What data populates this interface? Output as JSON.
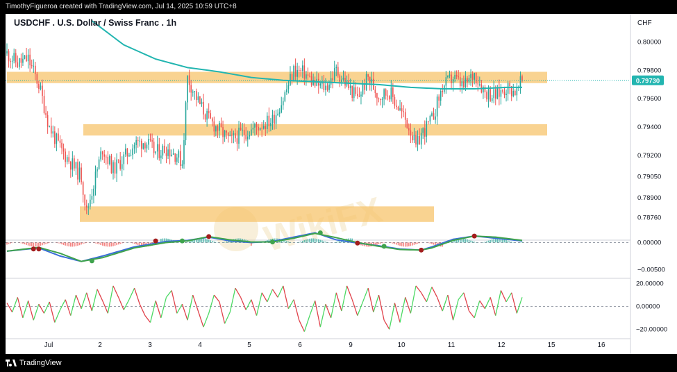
{
  "header": {
    "credit": "TimothyFigueroa created with TradingView.com, Jul 14, 2025 10:59 UTC+8"
  },
  "chart": {
    "title": "USDCHF . U.S. Dollar / Swiss Franc . 1h",
    "currency": "CHF",
    "watermark": "WikiFX",
    "footer_brand": "TradingView",
    "colors": {
      "up": "#26a69a",
      "down": "#ef5350",
      "zone": "#f7c46c",
      "ma": "#22b5b0",
      "macd_fast": "#3a6ed8",
      "macd_signal": "#3fa34d",
      "macd_down": "#a31d1d",
      "osc_up": "#4cd964",
      "osc_down": "#e0414a"
    }
  },
  "chart_data": [
    {
      "type": "candlestick",
      "title": "USDCHF . U.S. Dollar / Swiss Franc . 1h",
      "y_ticks": [
        0.8,
        0.798,
        0.796,
        0.794,
        0.792,
        0.7905,
        0.789,
        0.7876
      ],
      "y_tick_labels": [
        "0.80000",
        "0.79800",
        "0.79600",
        "0.79400",
        "0.79200",
        "0.79050",
        "0.78900",
        "0.78760"
      ],
      "ylim": [
        0.7868,
        0.8015
      ],
      "x_tick_labels": [
        "Jul",
        "2",
        "3",
        "4",
        "5",
        "6",
        "9",
        "10",
        "11",
        "12",
        "15",
        "16"
      ],
      "last_price": 0.7973,
      "last_price_label": "0.79730",
      "zones": [
        {
          "low": 0.7971,
          "high": 0.7979
        },
        {
          "low": 0.7934,
          "high": 0.7942
        },
        {
          "low": 0.7873,
          "high": 0.7884
        }
      ],
      "price_path": [
        [
          0,
          0.7992
        ],
        [
          2,
          0.7985
        ],
        [
          4,
          0.7988
        ],
        [
          6,
          0.797
        ],
        [
          8,
          0.794
        ],
        [
          10,
          0.7925
        ],
        [
          12,
          0.7915
        ],
        [
          14,
          0.7905
        ],
        [
          15,
          0.788
        ],
        [
          16,
          0.7895
        ],
        [
          18,
          0.7925
        ],
        [
          20,
          0.791
        ],
        [
          22,
          0.7918
        ],
        [
          24,
          0.7928
        ],
        [
          26,
          0.793
        ],
        [
          28,
          0.7922
        ],
        [
          30,
          0.7925
        ],
        [
          32,
          0.792
        ],
        [
          33,
          0.7915
        ],
        [
          34,
          0.7975
        ],
        [
          36,
          0.7958
        ],
        [
          38,
          0.7945
        ],
        [
          40,
          0.7938
        ],
        [
          42,
          0.793
        ],
        [
          44,
          0.7935
        ],
        [
          46,
          0.7938
        ],
        [
          48,
          0.7942
        ],
        [
          50,
          0.7945
        ],
        [
          52,
          0.796
        ],
        [
          54,
          0.798
        ],
        [
          56,
          0.7978
        ],
        [
          58,
          0.797
        ],
        [
          60,
          0.7968
        ],
        [
          62,
          0.798
        ],
        [
          64,
          0.797
        ],
        [
          66,
          0.796
        ],
        [
          68,
          0.7975
        ],
        [
          70,
          0.7962
        ],
        [
          72,
          0.7965
        ],
        [
          74,
          0.7952
        ],
        [
          76,
          0.7938
        ],
        [
          77,
          0.7925
        ],
        [
          78,
          0.7935
        ],
        [
          80,
          0.7945
        ],
        [
          82,
          0.7968
        ],
        [
          84,
          0.7975
        ],
        [
          86,
          0.7968
        ],
        [
          88,
          0.7978
        ],
        [
          90,
          0.7965
        ],
        [
          92,
          0.7962
        ],
        [
          94,
          0.7968
        ],
        [
          96,
          0.7965
        ],
        [
          97,
          0.7973
        ]
      ],
      "ma_path": [
        [
          16,
          0.8015
        ],
        [
          22,
          0.7998
        ],
        [
          28,
          0.7988
        ],
        [
          34,
          0.7982
        ],
        [
          40,
          0.7979
        ],
        [
          46,
          0.7975
        ],
        [
          52,
          0.7973
        ],
        [
          58,
          0.7972
        ],
        [
          64,
          0.7971
        ],
        [
          70,
          0.797
        ],
        [
          76,
          0.7968
        ],
        [
          82,
          0.7967
        ],
        [
          88,
          0.7967
        ],
        [
          94,
          0.7968
        ],
        [
          97,
          0.7968
        ]
      ]
    },
    {
      "type": "line",
      "name": "MACD",
      "y_ticks": [
        0.0,
        -0.005
      ],
      "y_tick_labels": [
        "0.00000",
        "−0.00500"
      ],
      "ylim": [
        -0.0065,
        0.0025
      ],
      "series": [
        {
          "name": "fast",
          "values": [
            [
              0,
              -0.0016
            ],
            [
              6,
              -0.001
            ],
            [
              10,
              -0.0025
            ],
            [
              14,
              -0.0035
            ],
            [
              18,
              -0.0025
            ],
            [
              24,
              -0.0008
            ],
            [
              30,
              0.0002
            ],
            [
              34,
              0.0004
            ],
            [
              38,
              0.001
            ],
            [
              42,
              0.0003
            ],
            [
              46,
              0.0
            ],
            [
              50,
              0.0002
            ],
            [
              54,
              0.001
            ],
            [
              58,
              0.0018
            ],
            [
              62,
              0.0005
            ],
            [
              66,
              -0.0001
            ],
            [
              70,
              -0.0006
            ],
            [
              74,
              -0.0012
            ],
            [
              78,
              -0.0014
            ],
            [
              80,
              -0.0008
            ],
            [
              84,
              0.0006
            ],
            [
              88,
              0.0012
            ],
            [
              92,
              0.0008
            ],
            [
              97,
              0.0003
            ]
          ]
        },
        {
          "name": "signal",
          "values": [
            [
              0,
              -0.0016
            ],
            [
              6,
              -0.0009
            ],
            [
              10,
              -0.002
            ],
            [
              14,
              -0.0035
            ],
            [
              18,
              -0.0028
            ],
            [
              24,
              -0.001
            ],
            [
              30,
              0.0
            ],
            [
              34,
              0.0003
            ],
            [
              38,
              0.0011
            ],
            [
              42,
              0.0005
            ],
            [
              46,
              0.0001
            ],
            [
              50,
              0.0001
            ],
            [
              54,
              0.0008
            ],
            [
              58,
              0.0017
            ],
            [
              62,
              0.0009
            ],
            [
              66,
              0.0
            ],
            [
              70,
              -0.0007
            ],
            [
              74,
              -0.0013
            ],
            [
              78,
              -0.0014
            ],
            [
              80,
              -0.001
            ],
            [
              84,
              0.0004
            ],
            [
              88,
              0.0012
            ],
            [
              92,
              0.001
            ],
            [
              97,
              0.0004
            ]
          ]
        }
      ],
      "cross_markers": [
        [
          5,
          -0.0012,
          "down"
        ],
        [
          6,
          -0.0012,
          "down"
        ],
        [
          16,
          -0.0034,
          "up"
        ],
        [
          28,
          0.0003,
          "down"
        ],
        [
          33,
          0.0003,
          "up"
        ],
        [
          38,
          0.0011,
          "down"
        ],
        [
          50,
          0.0001,
          "up"
        ],
        [
          59,
          0.0018,
          "up"
        ],
        [
          66,
          -0.0001,
          "down"
        ],
        [
          71,
          -0.0007,
          "up"
        ],
        [
          78,
          -0.0014,
          "down"
        ],
        [
          88,
          0.0012,
          "down"
        ]
      ]
    },
    {
      "type": "line",
      "name": "Oscillator",
      "y_ticks": [
        20,
        0,
        -20
      ],
      "y_tick_labels": [
        "20.00000",
        "0.00000",
        "−20.00000"
      ],
      "ylim": [
        -27,
        24
      ],
      "values": [
        [
          0,
          3
        ],
        [
          1,
          -5
        ],
        [
          2,
          8
        ],
        [
          3,
          -10
        ],
        [
          4,
          5
        ],
        [
          5,
          -12
        ],
        [
          6,
          2
        ],
        [
          7,
          -6
        ],
        [
          8,
          4
        ],
        [
          9,
          -14
        ],
        [
          10,
          -3
        ],
        [
          11,
          6
        ],
        [
          12,
          -8
        ],
        [
          13,
          10
        ],
        [
          14,
          -2
        ],
        [
          15,
          12
        ],
        [
          16,
          -4
        ],
        [
          17,
          15
        ],
        [
          18,
          5
        ],
        [
          19,
          -6
        ],
        [
          20,
          18
        ],
        [
          21,
          8
        ],
        [
          22,
          -3
        ],
        [
          23,
          6
        ],
        [
          24,
          16
        ],
        [
          25,
          2
        ],
        [
          26,
          -8
        ],
        [
          27,
          -14
        ],
        [
          28,
          5
        ],
        [
          29,
          -10
        ],
        [
          30,
          8
        ],
        [
          31,
          14
        ],
        [
          32,
          -6
        ],
        [
          33,
          2
        ],
        [
          34,
          -12
        ],
        [
          35,
          10
        ],
        [
          36,
          -4
        ],
        [
          37,
          -18
        ],
        [
          38,
          -6
        ],
        [
          39,
          10
        ],
        [
          40,
          4
        ],
        [
          41,
          -15
        ],
        [
          42,
          -5
        ],
        [
          43,
          16
        ],
        [
          44,
          8
        ],
        [
          45,
          -3
        ],
        [
          46,
          6
        ],
        [
          47,
          -8
        ],
        [
          48,
          12
        ],
        [
          49,
          4
        ],
        [
          50,
          15
        ],
        [
          51,
          8
        ],
        [
          52,
          18
        ],
        [
          53,
          -2
        ],
        [
          54,
          6
        ],
        [
          55,
          -12
        ],
        [
          56,
          -22
        ],
        [
          57,
          -8
        ],
        [
          58,
          5
        ],
        [
          59,
          -18
        ],
        [
          60,
          2
        ],
        [
          61,
          -10
        ],
        [
          62,
          12
        ],
        [
          63,
          -4
        ],
        [
          64,
          18
        ],
        [
          65,
          6
        ],
        [
          66,
          -8
        ],
        [
          67,
          4
        ],
        [
          68,
          16
        ],
        [
          69,
          -5
        ],
        [
          70,
          10
        ],
        [
          71,
          -12
        ],
        [
          72,
          -20
        ],
        [
          73,
          3
        ],
        [
          74,
          -14
        ],
        [
          75,
          8
        ],
        [
          76,
          -6
        ],
        [
          77,
          18
        ],
        [
          78,
          12
        ],
        [
          79,
          4
        ],
        [
          80,
          17
        ],
        [
          81,
          8
        ],
        [
          82,
          -4
        ],
        [
          83,
          10
        ],
        [
          84,
          -12
        ],
        [
          85,
          6
        ],
        [
          86,
          12
        ],
        [
          87,
          -4
        ],
        [
          88,
          -10
        ],
        [
          89,
          5
        ],
        [
          90,
          -2
        ],
        [
          91,
          8
        ],
        [
          92,
          -8
        ],
        [
          93,
          14
        ],
        [
          94,
          4
        ],
        [
          95,
          12
        ],
        [
          96,
          -6
        ],
        [
          97,
          8
        ]
      ]
    }
  ]
}
